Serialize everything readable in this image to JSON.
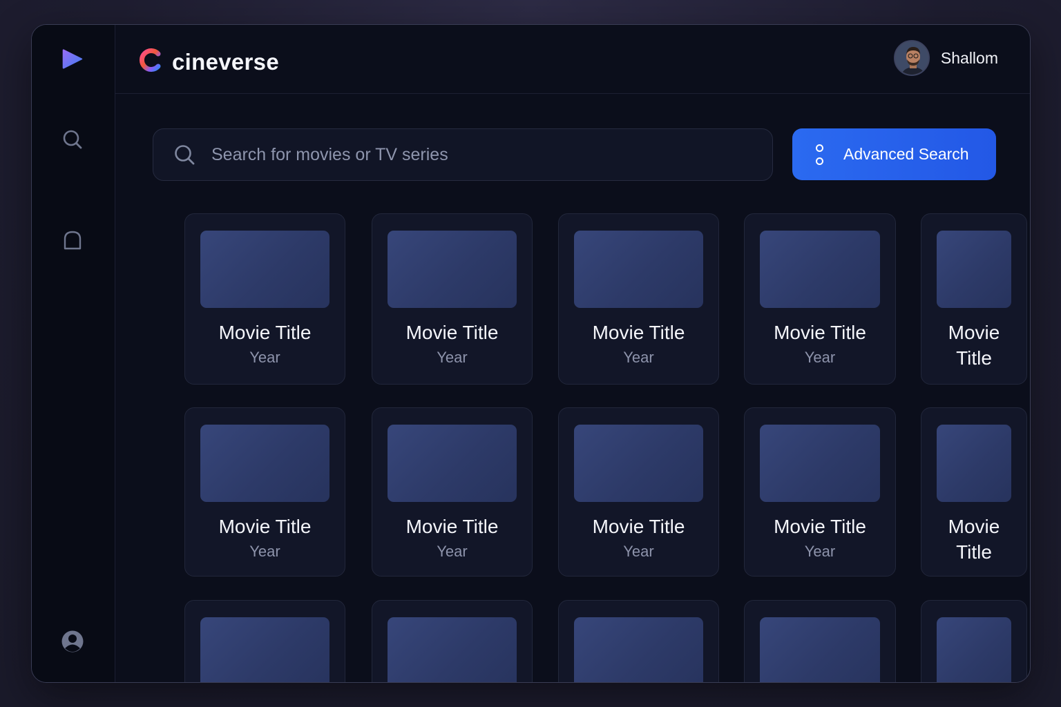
{
  "app": {
    "brand_name": "cineverse"
  },
  "user": {
    "name": "Shallom"
  },
  "sidebar": {
    "items": [
      {
        "icon": "play-logo-icon"
      },
      {
        "icon": "search-icon"
      },
      {
        "icon": "bookmark-icon"
      },
      {
        "icon": "profile-icon"
      }
    ]
  },
  "search": {
    "placeholder": "Search for movies or TV series"
  },
  "advanced_search": {
    "label": "Advanced Search",
    "icon": "options-icon"
  },
  "colors": {
    "accent": "#2563eb",
    "background": "#0b0e1b",
    "card": "#121628",
    "poster": "#33426f"
  },
  "movies": [
    {
      "title": "Movie Title",
      "year": "Year"
    },
    {
      "title": "Movie Title",
      "year": "Year"
    },
    {
      "title": "Movie Title",
      "year": "Year"
    },
    {
      "title": "Movie Title",
      "year": "Year"
    },
    {
      "title": "Movie Title",
      "year": ""
    },
    {
      "title": "Movie Title",
      "year": "Year"
    },
    {
      "title": "Movie Title",
      "year": "Year"
    },
    {
      "title": "Movie Title",
      "year": "Year"
    },
    {
      "title": "Movie Title",
      "year": "Year"
    },
    {
      "title": "Movie Title",
      "year": ""
    },
    {
      "title": "",
      "year": ""
    },
    {
      "title": "",
      "year": ""
    },
    {
      "title": "",
      "year": ""
    },
    {
      "title": "",
      "year": ""
    },
    {
      "title": "",
      "year": ""
    }
  ]
}
